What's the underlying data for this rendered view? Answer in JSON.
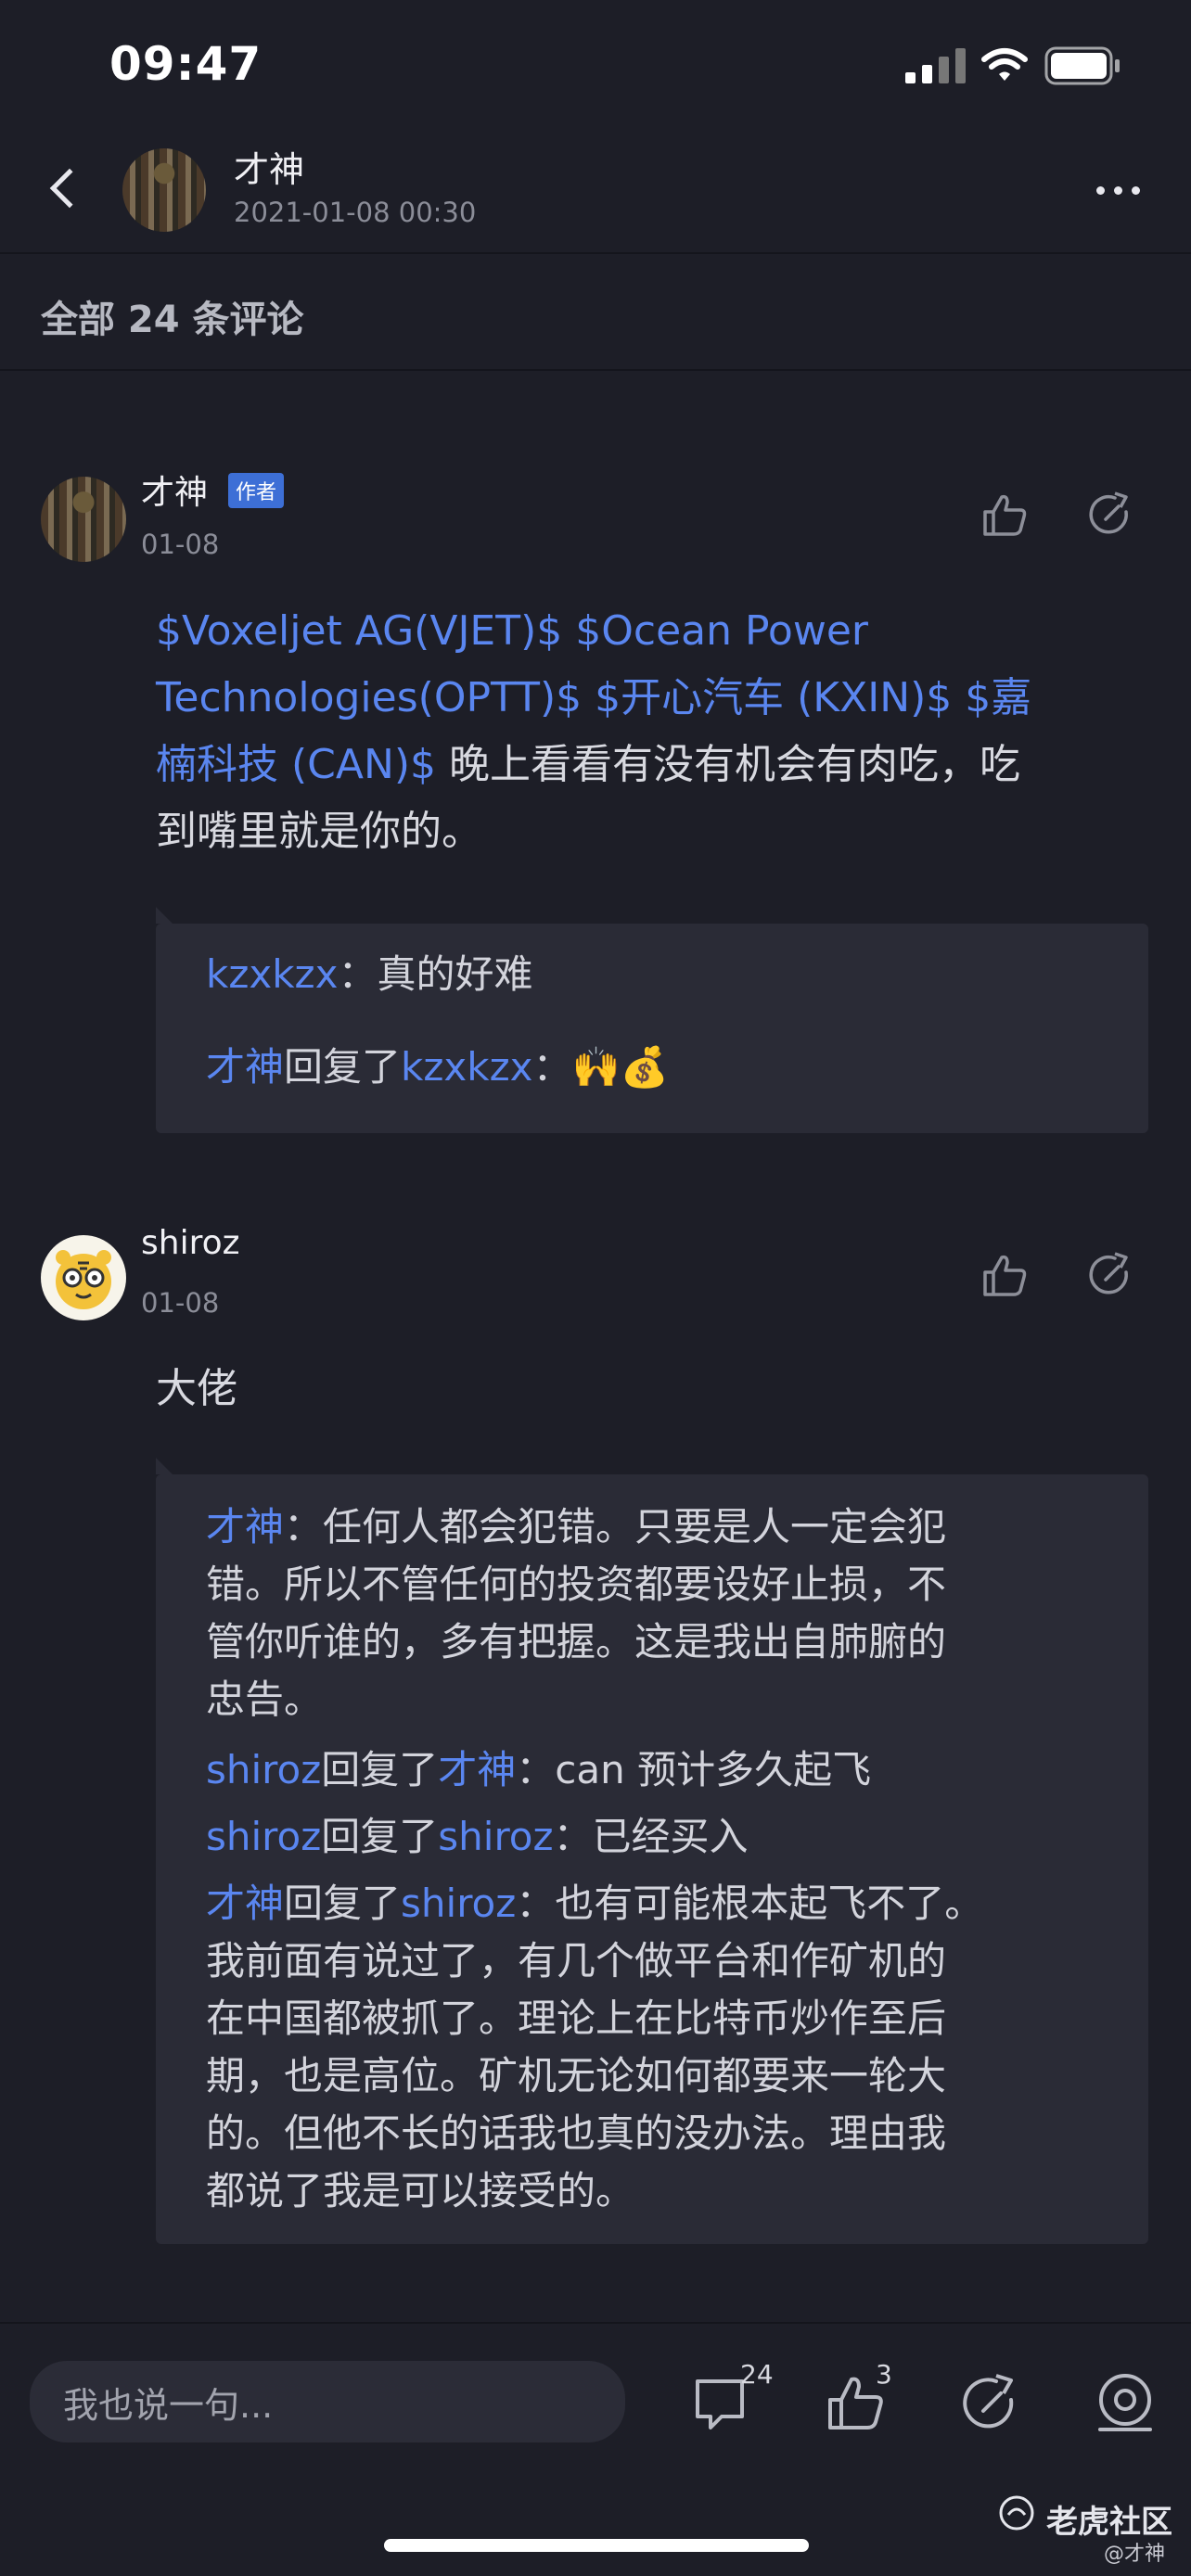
{
  "status_bar": {
    "time": "09:47"
  },
  "header": {
    "author": "才神",
    "datetime": "2021-01-08 00:30"
  },
  "comments_section": {
    "title": "全部 24 条评论"
  },
  "comments": [
    {
      "author": "才神",
      "badge": "作者",
      "date": "01-08",
      "body_lines": [
        [
          {
            "t": " $Voxeljet AG(VJET)$  $Ocean Power",
            "link": true
          }
        ],
        [
          {
            "t": "Technologies(OPTT)$  $开心汽车 (KXIN)$  $嘉",
            "link": true
          }
        ],
        [
          {
            "t": "楠科技 (CAN)$",
            "link": true
          },
          {
            "t": " 晚上看看有没有机会有肉吃，吃",
            "link": false
          }
        ],
        [
          {
            "t": "到嘴里就是你的。",
            "link": false
          }
        ]
      ],
      "replies": [
        {
          "user": "kzxkzx",
          "reply_to": "",
          "text": "：真的好难"
        },
        {
          "user": "才神",
          "reply_to": "kzxkzx",
          "text": "：🙌💰"
        }
      ]
    },
    {
      "author": "shiroz",
      "date": "01-08",
      "body": "大佬",
      "replies": [
        {
          "user": "才神",
          "reply_to": "",
          "lines": [
            "：任何人都会犯错。只要是人一定会犯",
            "错。所以不管任何的投资都要设好止损，不",
            "管你听谁的，多有把握。这是我出自肺腑的",
            "忠告。"
          ]
        },
        {
          "user": "shiroz",
          "reply_to": "才神",
          "lines": [
            "：can 预计多久起飞"
          ]
        },
        {
          "user": "shiroz",
          "reply_to": "shiroz",
          "lines": [
            "：已经买入"
          ]
        },
        {
          "user": "才神",
          "reply_to": "shiroz",
          "lines": [
            "：也有可能根本起飞不了。",
            "我前面有说过了，有几个做平台和作矿机的",
            "在中国都被抓了。理论上在比特币炒作至后",
            "期，也是高位。矿机无论如何都要来一轮大",
            "的。但他不长的话我也真的没办法。理由我",
            "都说了我是可以接受的。"
          ]
        }
      ]
    }
  ],
  "reply_verb": "回复了",
  "bottom_bar": {
    "input_placeholder": "我也说一句...",
    "comment_count": "24",
    "like_count": "3"
  },
  "watermark": {
    "brand": "老虎社区",
    "handle": "@才神"
  },
  "colors": {
    "link": "#5a86f0",
    "background": "#1d1e27",
    "reply_bg": "#2a2b36",
    "badge": "#3d6fd6"
  }
}
